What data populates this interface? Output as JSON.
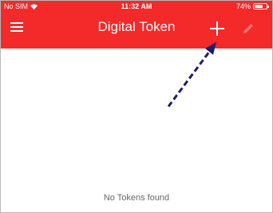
{
  "status_bar": {
    "carrier": "No SIM",
    "time": "11:32 AM",
    "battery_percent": "74%",
    "battery_level": 0.74
  },
  "header": {
    "title": "Digital Token",
    "menu_icon": "hamburger-menu-icon",
    "add_icon": "plus-icon",
    "edit_icon": "pencil-icon"
  },
  "content": {
    "empty_message": "No Tokens found"
  },
  "colors": {
    "header_background": "#f42929",
    "annotation_arrow": "#1c1c6e"
  }
}
